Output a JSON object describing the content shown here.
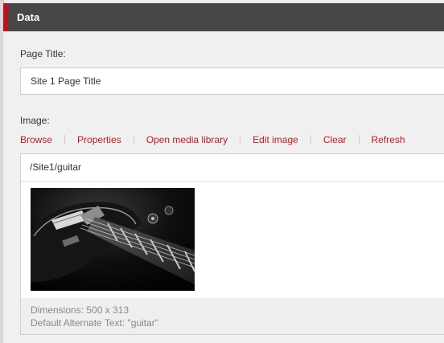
{
  "section": {
    "title": "Data"
  },
  "page_title": {
    "label": "Page Title:",
    "value": "Site 1 Page Title"
  },
  "image": {
    "label": "Image:",
    "actions": {
      "browse": "Browse",
      "properties": "Properties",
      "open_media_library": "Open media library",
      "edit_image": "Edit image",
      "clear": "Clear",
      "refresh": "Refresh"
    },
    "path": "/Site1/guitar",
    "thumbnail_icon": "guitar-photo",
    "dimensions": "Dimensions: 500 x 313",
    "alt_text": "Default Alternate Text: \"guitar\""
  },
  "colors": {
    "accent": "#c2101e",
    "header_bg": "#474747",
    "link": "#c4171f"
  }
}
